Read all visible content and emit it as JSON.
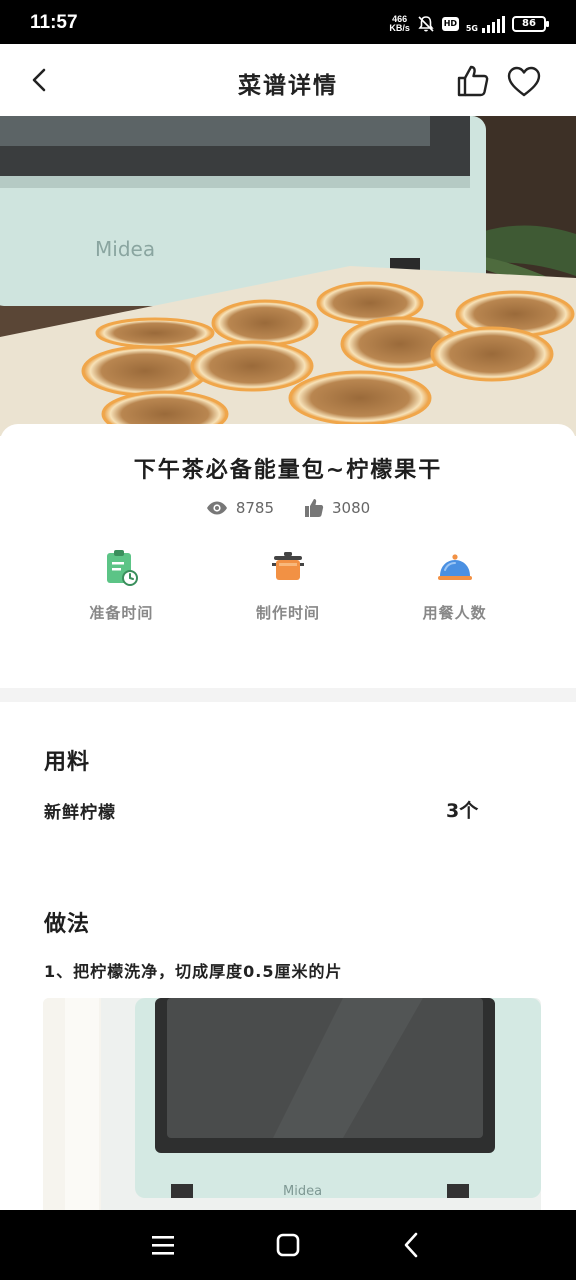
{
  "status_bar": {
    "time": "11:57",
    "net_speed_value": "466",
    "net_speed_unit": "KB/s",
    "hd_label": "HD",
    "signal_label": "5G",
    "battery": "86"
  },
  "header": {
    "title": "菜谱详情",
    "back_icon": "chevron-left-icon",
    "like_icon": "thumbs-up-icon",
    "favorite_icon": "heart-icon"
  },
  "recipe": {
    "title": "下午茶必备能量包~柠檬果干",
    "views": "8785",
    "likes": "3080",
    "meta": [
      {
        "label": "准备时间",
        "icon": "clipboard-icon"
      },
      {
        "label": "制作时间",
        "icon": "pot-icon"
      },
      {
        "label": "用餐人数",
        "icon": "food-cloche-icon"
      }
    ]
  },
  "ingredients": {
    "title": "用料",
    "items": [
      {
        "name": "新鲜柠檬",
        "amount": "3个"
      }
    ]
  },
  "steps": {
    "title": "做法",
    "items": [
      {
        "text": "1、把柠檬洗净，切成厚度0.5厘米的片"
      }
    ]
  },
  "images": {
    "hero_brand": "Midea",
    "step_brand": "Midea"
  },
  "colors": {
    "oven_mint": "#cfe4de",
    "lemon_orange": "#f0a64a",
    "meta_green": "#5cc486",
    "meta_orange": "#f29144",
    "meta_blue": "#4a90e2"
  }
}
